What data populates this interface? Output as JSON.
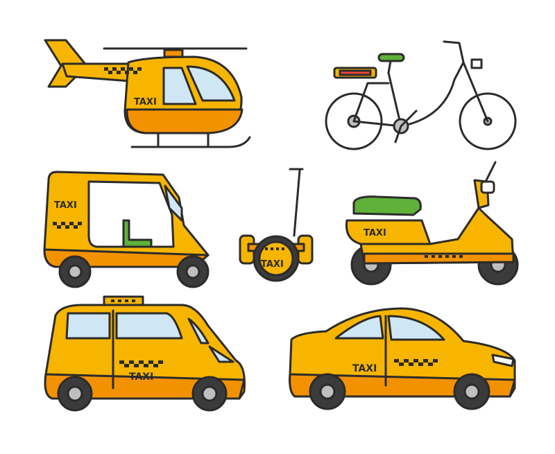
{
  "colors": {
    "yellow": "#f7b500",
    "orange": "#f39200",
    "glass": "#cfe6f5",
    "green": "#5fb13a",
    "red": "#e9453a",
    "ink": "#2b2b2b",
    "tire": "#3b3b3b",
    "rim": "#bfbfbf",
    "background": "#ffffff"
  },
  "labels": {
    "helicopter": "TAXI",
    "tuk_tuk": "TAXI",
    "segway": "TAXI",
    "scooter": "TAXI",
    "minivan": "TAXI",
    "sedan": "TAXI"
  },
  "vehicles": [
    "helicopter",
    "bicycle",
    "tuk-tuk",
    "segway",
    "scooter",
    "minivan",
    "sedan"
  ]
}
